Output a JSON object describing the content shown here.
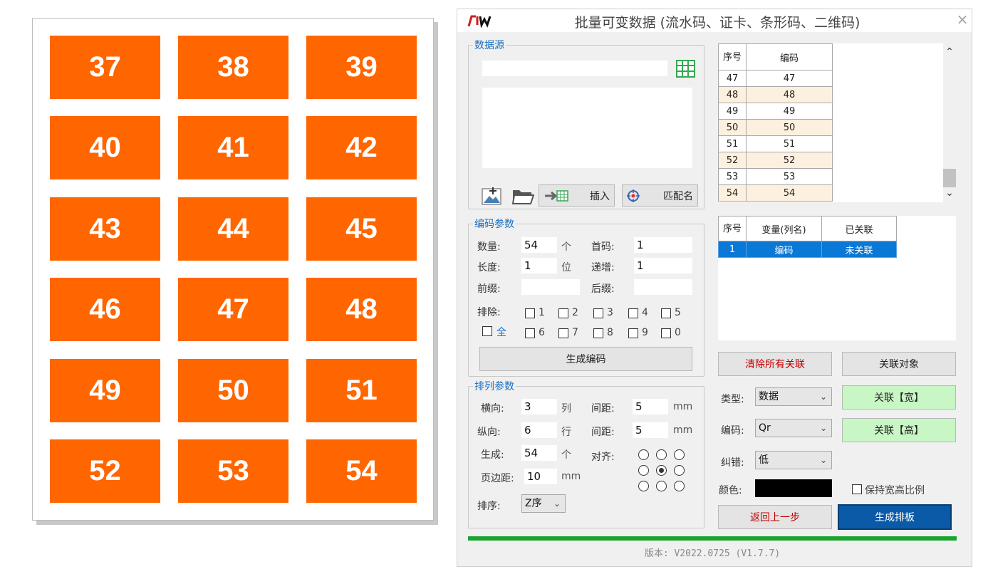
{
  "preview": {
    "labels": [
      "37",
      "38",
      "39",
      "40",
      "41",
      "42",
      "43",
      "44",
      "45",
      "46",
      "47",
      "48",
      "49",
      "50",
      "51",
      "52",
      "53",
      "54"
    ]
  },
  "dialog": {
    "title": "批量可变数据 (流水码、证卡、条形码、二维码)",
    "logo_text": "FIW",
    "close_label": "×",
    "datasource": {
      "legend": "数据源",
      "path_value": "",
      "insert_label": "插入",
      "match_label": "匹配名"
    },
    "code_params": {
      "legend": "编码参数",
      "count_label": "数量:",
      "count_value": "54",
      "count_unit": "个",
      "first_label": "首码:",
      "first_value": "1",
      "length_label": "长度:",
      "length_value": "1",
      "length_unit": "位",
      "inc_label": "递增:",
      "inc_value": "1",
      "prefix_label": "前缀:",
      "prefix_value": "",
      "suffix_label": "后缀:",
      "suffix_value": "",
      "exclude_label": "排除:",
      "exclude_row1": [
        "1",
        "2",
        "3",
        "4",
        "5"
      ],
      "exclude_row2": [
        "6",
        "7",
        "8",
        "9",
        "0"
      ],
      "all_label": "全",
      "generate_label": "生成编码"
    },
    "layout_params": {
      "legend": "排列参数",
      "horiz_label": "横向:",
      "horiz_value": "3",
      "horiz_unit": "列",
      "hgap_label": "间距:",
      "hgap_value": "5",
      "hgap_unit": "mm",
      "vert_label": "纵向:",
      "vert_value": "6",
      "vert_unit": "行",
      "vgap_label": "间距:",
      "vgap_value": "5",
      "vgap_unit": "mm",
      "gen_label": "生成:",
      "gen_value": "54",
      "gen_unit": "个",
      "align_label": "对齐:",
      "margin_label": "页边距:",
      "margin_value": "10",
      "margin_unit": "mm",
      "sort_label": "排序:",
      "sort_value": "Z序"
    },
    "code_table": {
      "col_index": "序号",
      "col_code": "编码",
      "rows": [
        {
          "idx": "47",
          "code": "47"
        },
        {
          "idx": "48",
          "code": "48"
        },
        {
          "idx": "49",
          "code": "49"
        },
        {
          "idx": "50",
          "code": "50"
        },
        {
          "idx": "51",
          "code": "51"
        },
        {
          "idx": "52",
          "code": "52"
        },
        {
          "idx": "53",
          "code": "53"
        },
        {
          "idx": "54",
          "code": "54"
        }
      ]
    },
    "var_table": {
      "col_index": "序号",
      "col_var": "变量(列名)",
      "col_linked": "已关联",
      "rows": [
        {
          "idx": "1",
          "var": "编码",
          "linked": "未关联"
        }
      ]
    },
    "clear_links_label": "清除所有关联",
    "link_object_label": "关联对象",
    "type_label": "类型:",
    "type_value": "数据",
    "encode_label": "编码:",
    "encode_value": "Qr",
    "ecc_label": "纠错:",
    "ecc_value": "低",
    "color_label": "颜色:",
    "link_width_label": "关联【宽】",
    "link_height_label": "关联【高】",
    "keep_ratio_label": "保持宽高比例",
    "back_label": "返回上一步",
    "generate_layout_label": "生成排板",
    "progress": 1.0,
    "version_text": "版本: V2022.0725 (V1.7.7)",
    "colors": {
      "label_bg": "#ff6600",
      "accent": "#1a6fc0",
      "progress": "#1aa32e",
      "selected_row": "#0a78d7",
      "link_btn": "#c8f7c5",
      "primary_btn": "#0a5aa8",
      "danger_text": "#c00000"
    }
  }
}
